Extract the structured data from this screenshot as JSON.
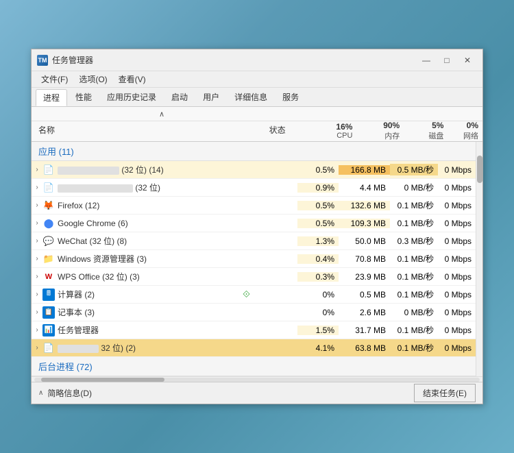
{
  "window": {
    "title": "任务管理器",
    "icon_label": "TM"
  },
  "menu": {
    "items": [
      "文件(F)",
      "选项(O)",
      "查看(V)"
    ]
  },
  "tabs": {
    "items": [
      "进程",
      "性能",
      "应用历史记录",
      "启动",
      "用户",
      "详细信息",
      "服务"
    ],
    "active": "进程"
  },
  "columns": {
    "sort_arrow": "∧",
    "name": "名称",
    "status": "状态",
    "cpu": {
      "pct": "16%",
      "label": "CPU"
    },
    "mem": {
      "pct": "90%",
      "label": "内存"
    },
    "disk": {
      "pct": "5%",
      "label": "磁盘"
    },
    "net": {
      "pct": "0%",
      "label": "网络"
    }
  },
  "sections": [
    {
      "title": "应用 (11)",
      "rows": [
        {
          "name_placeholder": true,
          "name_w": 120,
          "suffix": "(32 位) (14)",
          "icon": "📄",
          "cpu": "0.5%",
          "mem": "166.8 MB",
          "disk": "0.5 MB/秒",
          "net": "0 Mbps",
          "cpu_class": "cpu-low",
          "mem_class": "mem-med",
          "disk_class": "disk-med",
          "net_class": ""
        },
        {
          "name_placeholder": true,
          "name_w": 130,
          "suffix": "(32 位)",
          "icon": "📄",
          "cpu": "0.9%",
          "mem": "4.4 MB",
          "disk": "0 MB/秒",
          "net": "0 Mbps",
          "cpu_class": "cpu-low",
          "mem_class": "",
          "disk_class": "",
          "net_class": ""
        },
        {
          "name": "Firefox (12)",
          "icon": "🦊",
          "cpu": "0.5%",
          "mem": "132.6 MB",
          "disk": "0.1 MB/秒",
          "net": "0 Mbps",
          "cpu_class": "cpu-low",
          "mem_class": "mem-low",
          "disk_class": "",
          "net_class": ""
        },
        {
          "name": "Google Chrome (6)",
          "icon": "🌐",
          "cpu": "0.5%",
          "mem": "109.3 MB",
          "disk": "0.1 MB/秒",
          "net": "0 Mbps",
          "cpu_class": "cpu-low",
          "mem_class": "mem-low",
          "disk_class": "",
          "net_class": ""
        },
        {
          "name": "WeChat (32 位) (8)",
          "icon": "💬",
          "cpu": "1.3%",
          "mem": "50.0 MB",
          "disk": "0.3 MB/秒",
          "net": "0 Mbps",
          "cpu_class": "cpu-low",
          "mem_class": "",
          "disk_class": "",
          "net_class": ""
        },
        {
          "name": "Windows 资源管理器 (3)",
          "icon": "📁",
          "cpu": "0.4%",
          "mem": "70.8 MB",
          "disk": "0.1 MB/秒",
          "net": "0 Mbps",
          "cpu_class": "cpu-low",
          "mem_class": "",
          "disk_class": "",
          "net_class": ""
        },
        {
          "name": "WPS Office (32 位) (3)",
          "icon": "📝",
          "cpu": "0.3%",
          "mem": "23.9 MB",
          "disk": "0.1 MB/秒",
          "net": "0 Mbps",
          "cpu_class": "cpu-low",
          "mem_class": "",
          "disk_class": "",
          "net_class": ""
        },
        {
          "name": "计算器 (2)",
          "icon": "🖩",
          "cpu": "0%",
          "mem": "0.5 MB",
          "disk": "0.1 MB/秒",
          "net": "0 Mbps",
          "hint": true,
          "cpu_class": "",
          "mem_class": "",
          "disk_class": "",
          "net_class": ""
        },
        {
          "name": "记事本 (3)",
          "icon": "📋",
          "cpu": "0%",
          "mem": "2.6 MB",
          "disk": "0 MB/秒",
          "net": "0 Mbps",
          "cpu_class": "",
          "mem_class": "",
          "disk_class": "",
          "net_class": ""
        },
        {
          "name": "任务管理器",
          "icon": "📊",
          "cpu": "1.5%",
          "mem": "31.7 MB",
          "disk": "0.1 MB/秒",
          "net": "0 Mbps",
          "cpu_class": "cpu-low",
          "mem_class": "",
          "disk_class": "",
          "net_class": ""
        },
        {
          "name_placeholder": true,
          "name_w": 80,
          "suffix": "32 位) (2)",
          "icon": "📄",
          "cpu": "4.1%",
          "mem": "63.8 MB",
          "disk": "0.1 MB/秒",
          "net": "0 Mbps",
          "cpu_class": "cpu-med",
          "mem_class": "",
          "disk_class": "",
          "net_class": ""
        }
      ]
    },
    {
      "title": "后台进程 (72)",
      "rows": []
    }
  ],
  "status_bar": {
    "summary_label": "简略信息(D)",
    "end_task_label": "结束任务(E)"
  },
  "icons": {
    "firefox": "🦊",
    "chrome": "⚙",
    "wechat": "💬",
    "explorer": "📁",
    "wps": "W",
    "calc": "🖩",
    "notepad": "📄",
    "taskmanager": "📊"
  }
}
